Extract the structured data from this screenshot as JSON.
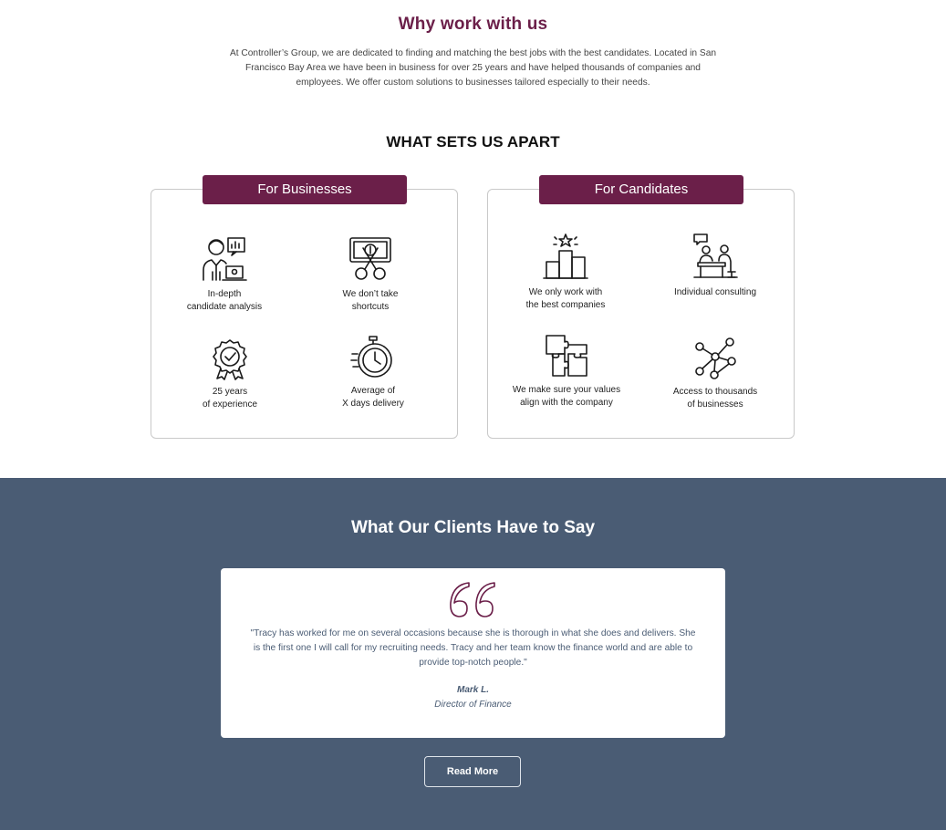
{
  "why": {
    "title": "Why work with us",
    "text": "At Controller’s Group, we are dedicated to finding and matching the best jobs with the best candidates. Located in San Francisco Bay Area we have been in business for over 25 years and have helped thousands of companies and employees. We offer custom solutions to businesses tailored especially to their needs."
  },
  "apart": {
    "title": "WHAT SETS US APART",
    "businesses": {
      "heading": "For Businesses",
      "items": [
        {
          "label": "In-depth\ncandidate analysis",
          "icon": "candidate-analysis-icon"
        },
        {
          "label": "We don’t take\nshortcuts",
          "icon": "scissors-money-icon"
        },
        {
          "label": "25 years\nof experience",
          "icon": "award-badge-icon"
        },
        {
          "label": "Average of\nX days delivery",
          "icon": "stopwatch-icon"
        }
      ]
    },
    "candidates": {
      "heading": "For Candidates",
      "items": [
        {
          "label": "We only work with\nthe best companies",
          "icon": "podium-star-icon"
        },
        {
          "label": "Individual consulting",
          "icon": "consulting-icon"
        },
        {
          "label": "We make sure your values\nalign with the company",
          "icon": "puzzle-icon"
        },
        {
          "label": "Access to thousands\nof businesses",
          "icon": "network-icon"
        }
      ]
    }
  },
  "clients": {
    "title": "What Our Clients Have to Say",
    "quote": "\"Tracy has worked for me on several occasions because she is thorough in what she does and delivers. She is the first one I will call for my recruiting needs. Tracy and her team know the finance world and are able to provide top-notch people.\"",
    "author": "Mark L.",
    "role": "Director of Finance",
    "button": "Read More"
  },
  "colors": {
    "brand": "#6b1f49",
    "slate": "#4a5c74"
  }
}
